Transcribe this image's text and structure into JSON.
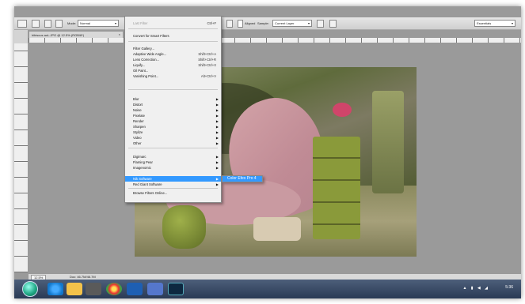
{
  "options_bar": {
    "mode_label": "Mode:",
    "mode_value": "Normal",
    "align_label": "Aligned",
    "sample_label": "Sample:",
    "sample_value": "Current Layer",
    "workspace_value": "Essentials"
  },
  "document": {
    "tab_title": "hibiscus aoL.JPG @ 12.5% (RGB/8*)",
    "close_glyph": "×"
  },
  "filter_menu": {
    "items": [
      {
        "label": "Last Filter",
        "shortcut": "Ctrl+F",
        "disabled": true
      },
      {
        "label": "Convert for Smart Filters"
      },
      {
        "label": "Filter Gallery..."
      },
      {
        "label": "Adaptive Wide Angle...",
        "shortcut": "Shift+Ctrl+A"
      },
      {
        "label": "Lens Correction...",
        "shortcut": "Shift+Ctrl+R"
      },
      {
        "label": "Liquify...",
        "shortcut": "Shift+Ctrl+X"
      },
      {
        "label": "Oil Paint..."
      },
      {
        "label": "Vanishing Point...",
        "shortcut": "Alt+Ctrl+V"
      },
      {
        "label": "Blur",
        "submenu": true
      },
      {
        "label": "Distort",
        "submenu": true
      },
      {
        "label": "Noise",
        "submenu": true
      },
      {
        "label": "Pixelate",
        "submenu": true
      },
      {
        "label": "Render",
        "submenu": true
      },
      {
        "label": "Sharpen",
        "submenu": true
      },
      {
        "label": "Stylize",
        "submenu": true
      },
      {
        "label": "Video",
        "submenu": true
      },
      {
        "label": "Other",
        "submenu": true
      },
      {
        "label": "Digimarc",
        "submenu": true
      },
      {
        "label": "Flaming Pear",
        "submenu": true
      },
      {
        "label": "Imagenomic",
        "submenu": true
      },
      {
        "label": "Nik Software",
        "submenu": true,
        "highlighted": true
      },
      {
        "label": "Red Giant Software",
        "submenu": true
      },
      {
        "label": "Browse Filters Online..."
      }
    ],
    "submenu_arrow": "▶"
  },
  "submenu": {
    "item": "Color Efex Pro 4"
  },
  "status_bar": {
    "zoom": "12.5%",
    "doc_info": "Doc: 46.7M/46.7M"
  },
  "taskbar": {
    "clock": "5:36",
    "tray": "▲ ▮ ◀ ◢"
  },
  "colors": {
    "menu_highlight": "#3399ff",
    "taskbar": "#2a3a55",
    "workspace": "#9a9a9a"
  }
}
